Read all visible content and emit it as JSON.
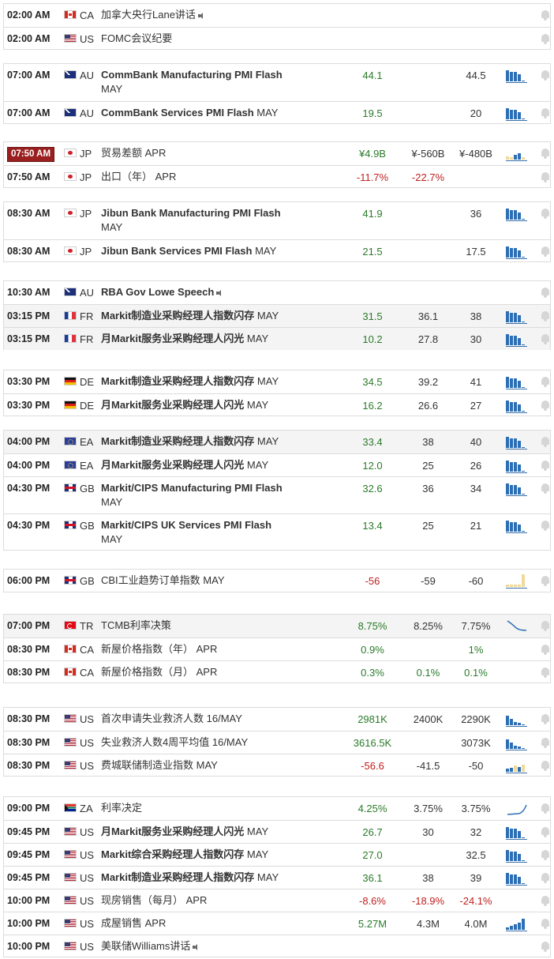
{
  "groups": [
    {
      "rows": [
        {
          "time": "02:00 AM",
          "ccy": "CA",
          "event": "加拿大央行Lane讲话",
          "speech": true
        },
        {
          "time": "02:00 AM",
          "ccy": "US",
          "event": "FOMC会议纪要"
        }
      ]
    },
    {
      "rows": [
        {
          "time": "07:00 AM",
          "ccy": "AU",
          "event": "CommBank Manufacturing PMI Flash",
          "sub": "MAY",
          "actual": "44.1",
          "actual_color": "green",
          "forecast": "",
          "previous": "44.5",
          "chart": "bars"
        },
        {
          "time": "07:00 AM",
          "ccy": "AU",
          "event": "CommBank Services PMI Flash",
          "period": "MAY",
          "actual": "19.5",
          "actual_color": "green",
          "forecast": "",
          "previous": "20",
          "chart": "bars"
        }
      ]
    },
    {
      "rows": [
        {
          "time": "07:50 AM",
          "badge": true,
          "ccy": "JP",
          "event": "贸易差额",
          "period": "APR",
          "actual": "¥4.9B",
          "actual_color": "green",
          "forecast": "¥-560B",
          "previous": "¥-480B",
          "chart": "mixed"
        },
        {
          "time": "07:50 AM",
          "ccy": "JP",
          "event": "出口（年）",
          "period": "APR",
          "actual": "-11.7%",
          "actual_color": "red",
          "forecast": "-22.7%",
          "forecast_color": "red",
          "previous": "",
          "chart": "none"
        }
      ]
    },
    {
      "rows": [
        {
          "time": "08:30 AM",
          "ccy": "JP",
          "event": "Jibun Bank Manufacturing PMI Flash",
          "sub": "MAY",
          "actual": "41.9",
          "actual_color": "green",
          "forecast": "",
          "previous": "36",
          "chart": "bars"
        },
        {
          "time": "08:30 AM",
          "ccy": "JP",
          "event": "Jibun Bank Services PMI Flash",
          "period": "MAY",
          "actual": "21.5",
          "actual_color": "green",
          "forecast": "",
          "previous": "17.5",
          "chart": "bars"
        }
      ]
    },
    {
      "rows": [
        {
          "time": "10:30 AM",
          "ccy": "AU",
          "event": "RBA Gov Lowe Speech",
          "speech": true
        },
        {
          "time": "03:15 PM",
          "ccy": "FR",
          "event": "Markit制造业采购经理人指数闪存",
          "period": "MAY",
          "actual": "31.5",
          "actual_color": "green",
          "forecast": "36.1",
          "previous": "38",
          "chart": "bars"
        },
        {
          "time": "03:15 PM",
          "ccy": "FR",
          "event": "月Markit服务业采购经理人闪光",
          "period": "MAY",
          "actual": "10.2",
          "actual_color": "green",
          "forecast": "27.8",
          "previous": "30",
          "chart": "bars"
        }
      ]
    },
    {
      "rows": [
        {
          "time": "03:30 PM",
          "ccy": "DE",
          "event": "Markit制造业采购经理人指数闪存",
          "period": "MAY",
          "actual": "34.5",
          "actual_color": "green",
          "forecast": "39.2",
          "previous": "41",
          "chart": "bars"
        },
        {
          "time": "03:30 PM",
          "ccy": "DE",
          "event": "月Markit服务业采购经理人闪光",
          "period": "MAY",
          "actual": "16.2",
          "actual_color": "green",
          "forecast": "26.6",
          "previous": "27",
          "chart": "bars"
        }
      ]
    },
    {
      "rows": [
        {
          "time": "04:00 PM",
          "ccy": "EA",
          "event": "Markit制造业采购经理人指数闪存",
          "period": "MAY",
          "actual": "33.4",
          "actual_color": "green",
          "forecast": "38",
          "previous": "40",
          "chart": "bars"
        },
        {
          "time": "04:00 PM",
          "ccy": "EA",
          "event": "月Markit服务业采购经理人闪光",
          "period": "MAY",
          "actual": "12.0",
          "actual_color": "green",
          "forecast": "25",
          "previous": "26",
          "chart": "bars"
        },
        {
          "time": "04:30 PM",
          "ccy": "GB",
          "event": "Markit/CIPS Manufacturing PMI Flash",
          "sub": "MAY",
          "actual": "32.6",
          "actual_color": "green",
          "forecast": "36",
          "previous": "34",
          "chart": "bars"
        },
        {
          "time": "04:30 PM",
          "ccy": "GB",
          "event": "Markit/CIPS UK Services PMI Flash",
          "sub": "MAY",
          "actual": "13.4",
          "actual_color": "green",
          "forecast": "25",
          "previous": "21",
          "chart": "bars"
        }
      ]
    },
    {
      "rows": [
        {
          "time": "06:00 PM",
          "ccy": "GB",
          "event": "CBI工业趋势订单指数",
          "period": "MAY",
          "actual": "-56",
          "actual_color": "red",
          "forecast": "-59",
          "previous": "-60",
          "chart": "neg"
        }
      ]
    },
    {
      "rows": [
        {
          "time": "07:00 PM",
          "ccy": "TR",
          "event": "TCMB利率决策",
          "actual": "8.75%",
          "actual_color": "green",
          "forecast": "8.25%",
          "previous": "7.75%",
          "chart": "down"
        },
        {
          "time": "08:30 PM",
          "ccy": "CA",
          "event": "新屋价格指数（年）",
          "period": "APR",
          "actual": "0.9%",
          "actual_color": "green",
          "forecast": "",
          "previous": "1%",
          "previous_color": "green",
          "chart": "none"
        },
        {
          "time": "08:30 PM",
          "ccy": "CA",
          "event": "新屋价格指数（月）",
          "period": "APR",
          "actual": "0.3%",
          "actual_color": "green",
          "forecast": "0.1%",
          "forecast_color": "green",
          "previous": "0.1%",
          "previous_color": "green",
          "chart": "none"
        }
      ]
    },
    {
      "rows": [
        {
          "time": "08:30 PM",
          "ccy": "US",
          "event": "首次申请失业救济人数",
          "period": "16/MAY",
          "actual": "2981K",
          "actual_color": "green",
          "forecast": "2400K",
          "previous": "2290K",
          "chart": "bars2"
        },
        {
          "time": "08:30 PM",
          "ccy": "US",
          "event": "失业救济人数4周平均值",
          "period": "16/MAY",
          "actual": "3616.5K",
          "actual_color": "green",
          "forecast": "",
          "previous": "3073K",
          "chart": "bars2"
        },
        {
          "time": "08:30 PM",
          "ccy": "US",
          "event": "费城联储制造业指数",
          "period": "MAY",
          "actual": "-56.6",
          "actual_color": "red",
          "forecast": "-41.5",
          "previous": "-50",
          "chart": "mixed2"
        }
      ]
    },
    {
      "rows": [
        {
          "time": "09:00 PM",
          "ccy": "ZA",
          "event": "利率决定",
          "actual": "4.25%",
          "actual_color": "green",
          "forecast": "3.75%",
          "previous": "3.75%",
          "chart": "up"
        },
        {
          "time": "09:45 PM",
          "ccy": "US",
          "event": "月Markit服务业采购经理人闪光",
          "period": "MAY",
          "actual": "26.7",
          "actual_color": "green",
          "forecast": "30",
          "previous": "32",
          "chart": "bars"
        },
        {
          "time": "09:45 PM",
          "ccy": "US",
          "event": "Markit综合采购经理人指数闪存",
          "period": "MAY",
          "actual": "27.0",
          "actual_color": "green",
          "forecast": "",
          "previous": "32.5",
          "chart": "bars"
        },
        {
          "time": "09:45 PM",
          "ccy": "US",
          "event": "Markit制造业采购经理人指数闪存",
          "period": "MAY",
          "actual": "36.1",
          "actual_color": "green",
          "forecast": "38",
          "previous": "39",
          "chart": "bars"
        },
        {
          "time": "10:00 PM",
          "ccy": "US",
          "event": "现房销售（每月）",
          "period": "APR",
          "actual": "-8.6%",
          "actual_color": "red",
          "forecast": "-18.9%",
          "forecast_color": "red",
          "previous": "-24.1%",
          "previous_color": "red",
          "chart": "none"
        },
        {
          "time": "10:00 PM",
          "ccy": "US",
          "event": "成屋销售",
          "period": "APR",
          "actual": "5.27M",
          "actual_color": "green",
          "forecast": "4.3M",
          "previous": "4.0M",
          "chart": "bars3"
        },
        {
          "time": "10:00 PM",
          "ccy": "US",
          "event": "美联储Williams讲话",
          "speech": true
        }
      ]
    }
  ]
}
